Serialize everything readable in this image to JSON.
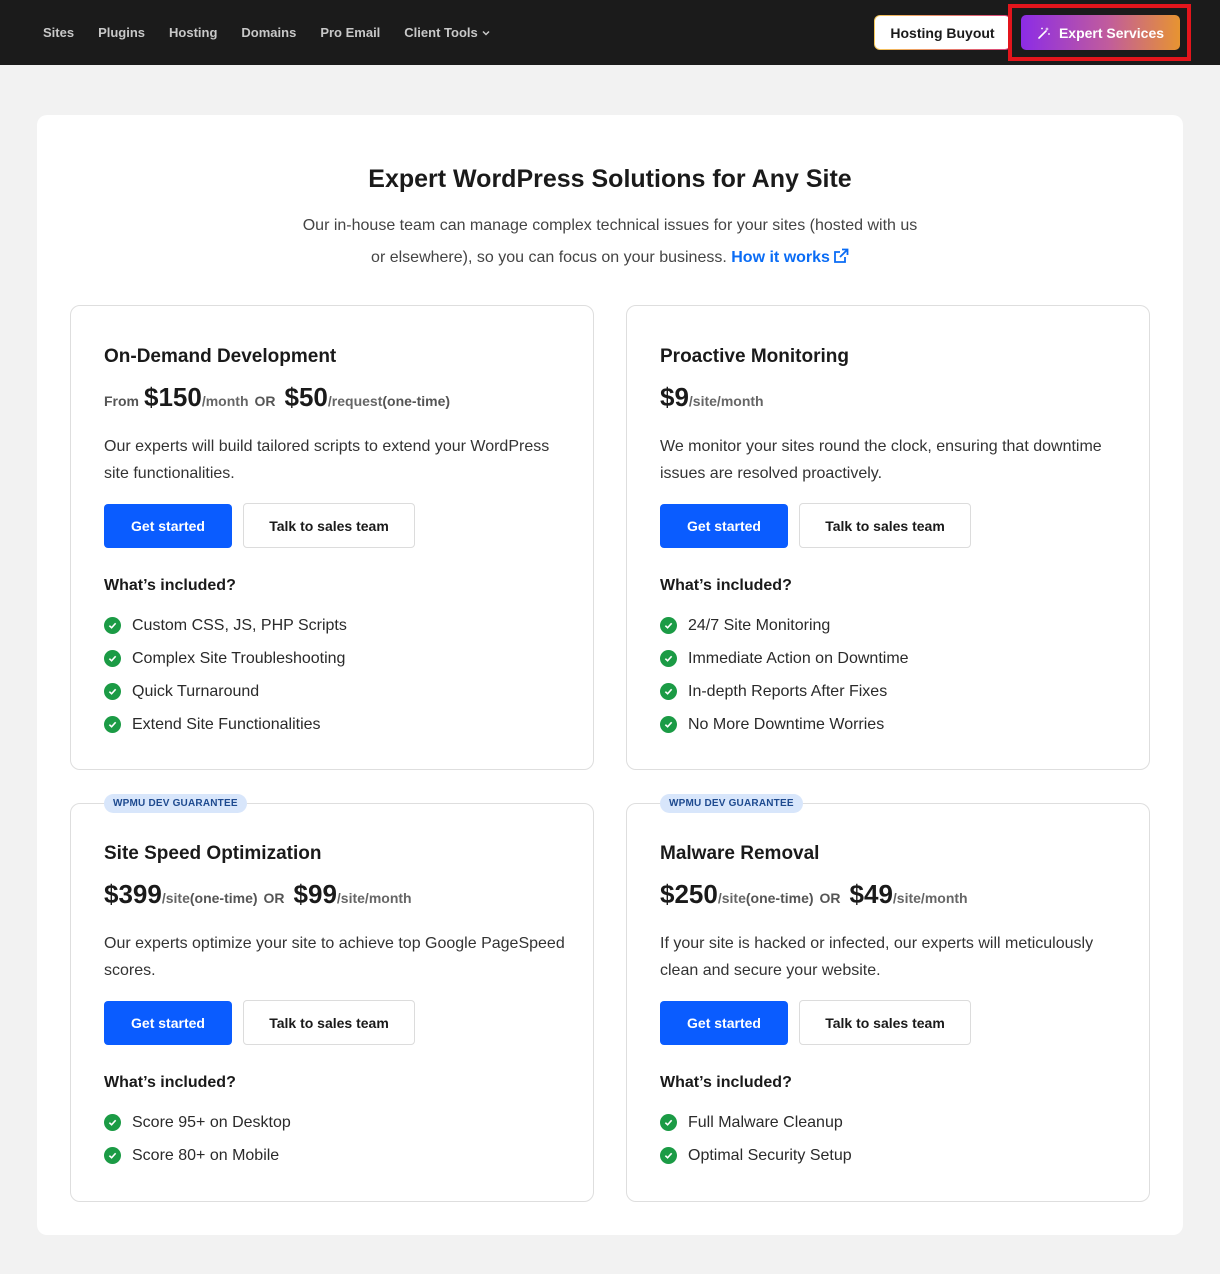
{
  "topbar": {
    "nav": [
      "Sites",
      "Plugins",
      "Hosting",
      "Domains",
      "Pro Email",
      "Client Tools"
    ],
    "hosting_buyout": "Hosting Buyout",
    "expert_services": "Expert Services"
  },
  "header": {
    "title": "Expert WordPress Solutions for Any Site",
    "intro_line1": "Our in-house team can manage complex technical issues for your sites (hosted with us",
    "intro_line2": "or elsewhere), so you can focus on your business.",
    "link": "How it works"
  },
  "cards": [
    {
      "title": "On-Demand Development",
      "from": "From",
      "price1": "$150",
      "unit1": "/month",
      "or": "OR",
      "price2": "$50",
      "unit2": "/request",
      "note2": " (one-time)",
      "description": "Our experts will build tailored scripts to extend your WordPress site functionalities.",
      "cta": "Get started",
      "sales": "Talk to sales team",
      "included_label": "What’s included?",
      "features": [
        "Custom CSS, JS, PHP Scripts",
        "Complex Site Troubleshooting",
        "Quick Turnaround",
        "Extend Site Functionalities"
      ]
    },
    {
      "title": "Proactive Monitoring",
      "price1": "$9",
      "unit1": "/site/month",
      "description": "We monitor your sites round the clock, ensuring that downtime issues are resolved proactively.",
      "cta": "Get started",
      "sales": "Talk to sales team",
      "included_label": "What’s included?",
      "features": [
        "24/7 Site Monitoring",
        "Immediate Action on Downtime",
        "In-depth Reports After Fixes",
        "No More Downtime Worries"
      ]
    },
    {
      "badge": "WPMU DEV GUARANTEE",
      "title": "Site Speed Optimization",
      "price1": "$399",
      "unit1": "/site",
      "note1": " (one-time)",
      "or": "OR",
      "price2": "$99",
      "unit2": "/site/month",
      "description": "Our experts optimize your site to achieve top Google PageSpeed scores.",
      "cta": "Get started",
      "sales": "Talk to sales team",
      "included_label": "What’s included?",
      "features": [
        "Score 95+ on Desktop",
        "Score 80+ on Mobile"
      ]
    },
    {
      "badge": "WPMU DEV GUARANTEE",
      "title": "Malware Removal",
      "price1": "$250",
      "unit1": "/site",
      "note1": " (one-time)",
      "or": "OR",
      "price2": "$49",
      "unit2": "/site/month",
      "description": "If your site is hacked or infected, our experts will meticulously clean and secure your website.",
      "cta": "Get started",
      "sales": "Talk to sales team",
      "included_label": "What’s included?",
      "features": [
        "Full Malware Cleanup",
        "Optimal Security Setup"
      ]
    }
  ]
}
